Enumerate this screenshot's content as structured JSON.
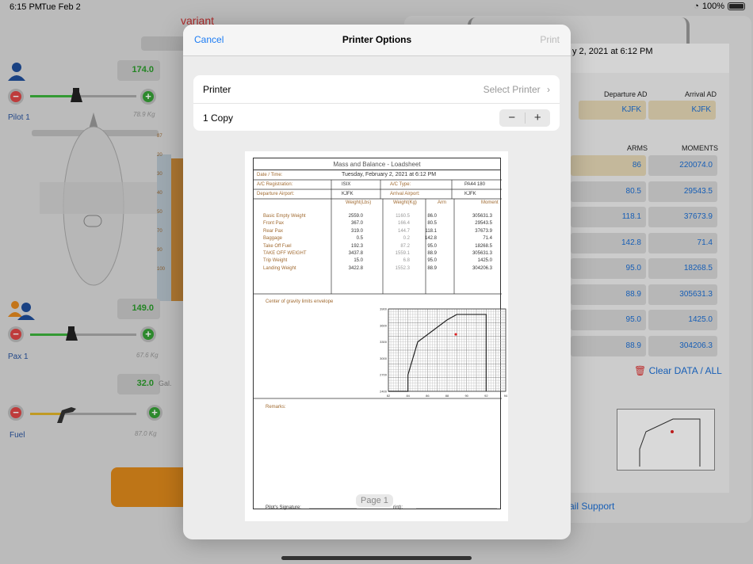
{
  "status": {
    "time": "6:15 PM",
    "date": "Tue Feb 2",
    "battery": "100%"
  },
  "background": {
    "variant_label": "variant",
    "pilot": {
      "value": "174.0",
      "label": "Pilot 1",
      "kg": "78.9 Kg"
    },
    "pax": {
      "value": "149.0",
      "label": "Pax 1",
      "kg": "67.6 Kg"
    },
    "fuel": {
      "value": "32.0",
      "unit": "Gal.",
      "label": "Fuel",
      "kg": "87.0 Kg"
    },
    "right": {
      "date_fragment": "y 2, 2021 at 6:12 PM",
      "dep_label": "Departure AD",
      "arr_label": "Arrival AD",
      "dep_value": "KJFK",
      "arr_value": "KJFK",
      "col_arms": "ARMS",
      "col_moments": "MOMENTS",
      "rows": [
        {
          "arm": "86",
          "moment": "220074.0",
          "tan": true
        },
        {
          "arm": "80.5",
          "moment": "29543.5",
          "tan": false
        },
        {
          "arm": "118.1",
          "moment": "37673.9",
          "tan": false
        },
        {
          "arm": "142.8",
          "moment": "71.4",
          "tan": false
        },
        {
          "arm": "95.0",
          "moment": "18268.5",
          "tan": false
        },
        {
          "arm": "88.9",
          "moment": "305631.3",
          "tan": false
        },
        {
          "arm": "95.0",
          "moment": "1425.0",
          "tan": false
        },
        {
          "arm": "88.9",
          "moment": "304206.3",
          "tan": false
        }
      ],
      "clear_label": "Clear DATA / ALL",
      "support_label": "ail Support"
    }
  },
  "dialog": {
    "cancel": "Cancel",
    "title": "Printer Options",
    "print": "Print",
    "printer_label": "Printer",
    "printer_value": "Select Printer",
    "copies_label": "1 Copy",
    "minus": "−",
    "plus": "+"
  },
  "sheet": {
    "title": "Mass and Balance - Loadsheet",
    "date_label": "Date / Time:",
    "date_value": "Tuesday, February 2, 2021 at 6:12 PM",
    "reg_label": "A/C Registration:",
    "reg_value": "ISIX",
    "type_label": "A/C Type:",
    "type_value": "PA44 180",
    "dep_label": "Departure Airport:",
    "dep_value": "KJFK",
    "arr_label": "Arrival Airport:",
    "arr_value": "KJFK",
    "col_lbs": "Weight(Lbs)",
    "col_kg": "Weight(Kg)",
    "col_arm": "Arm",
    "col_moment": "Moment",
    "rows": [
      {
        "name": "Basic Empty Weight",
        "lbs": "2559.0",
        "kg": "1160.5",
        "arm": "86.0",
        "moment": "305631.3"
      },
      {
        "name": "Front Pax",
        "lbs": "367.0",
        "kg": "166.4",
        "arm": "80.5",
        "moment": "29543.5"
      },
      {
        "name": "Rear Pax",
        "lbs": "319.0",
        "kg": "144.7",
        "arm": "118.1",
        "moment": "37673.9"
      },
      {
        "name": "Baggage",
        "lbs": "0.5",
        "kg": "0.2",
        "arm": "142.8",
        "moment": "71.4"
      },
      {
        "name": "Take Off Fuel",
        "lbs": "192.3",
        "kg": "87.2",
        "arm": "95.0",
        "moment": "18268.5"
      },
      {
        "name": "TAKE OFF WEIGHT",
        "lbs": "3437.8",
        "kg": "1559.1",
        "arm": "88.9",
        "moment": "305631.3"
      },
      {
        "name": "Trip Weight",
        "lbs": "15.0",
        "kg": "6.8",
        "arm": "95.0",
        "moment": "1425.0"
      },
      {
        "name": "Landing Weight",
        "lbs": "3422.8",
        "kg": "1552.3",
        "arm": "88.9",
        "moment": "304206.3"
      }
    ],
    "cg_label": "Center of gravity limits envelope",
    "remarks_label": "Remarks:",
    "signature_label": "Pilot's Signature:",
    "print_label": "rint):",
    "page_label": "Page 1"
  },
  "chart_data": {
    "type": "line",
    "series": [
      {
        "x": [
          82,
          84,
          84,
          85,
          88,
          89,
          92,
          92
        ],
        "y": [
          2400,
          2400,
          2700,
          3300,
          3700,
          3800,
          3800,
          2400
        ]
      }
    ],
    "points": [
      {
        "x": 88.9,
        "y": 3437.8
      }
    ],
    "xticks": [
      "82",
      "84",
      "86",
      "88",
      "90",
      "92",
      "94"
    ],
    "yticks": [
      "2400",
      "2700",
      "3000",
      "3300",
      "3600",
      "3900"
    ],
    "xlim": [
      82,
      94
    ],
    "ylim": [
      2400,
      3900
    ]
  }
}
